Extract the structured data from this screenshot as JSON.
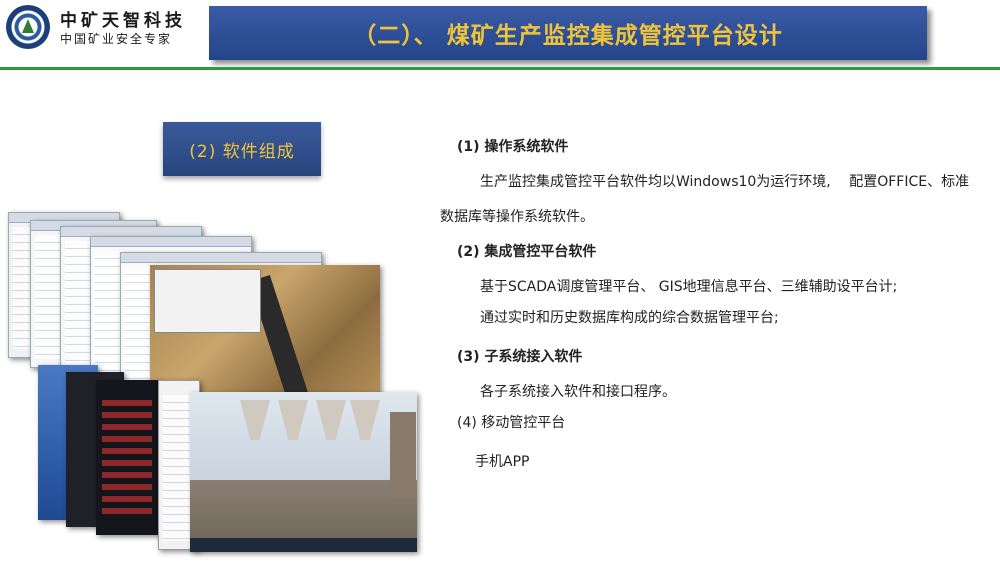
{
  "header": {
    "company_name": "中矿天智科技",
    "company_slogan": "中国矿业安全专家",
    "title": "（二）、 煤矿生产监控集成管控平台设计"
  },
  "section_label": "(2) 软件组成",
  "content": {
    "item1_heading": "(1) 操作系统软件",
    "item1_line1": "生产监控集成管控平台软件均以Windows10为运行环境,　 配置OFFICE、标准",
    "item1_line2": "数据库等操作系统软件。",
    "item2_heading": "(2) 集成管控平台软件",
    "item2_line1": "基于SCADA调度管理平台、 GIS地理信息平台、三维辅助设平台计;",
    "item2_line2": "通过实时和历史数据库构成的综合数据管理平台;",
    "item3_heading": "(3) 子系统接入软件",
    "item3_line1": "各子系统接入软件和接口程序。",
    "item4_heading": "(4) 移动管控平台",
    "item4_line1": "手机APP"
  },
  "colors": {
    "title_banner": "#2e4f98",
    "title_text": "#f0c43a",
    "divider": "#2d9a3f"
  }
}
